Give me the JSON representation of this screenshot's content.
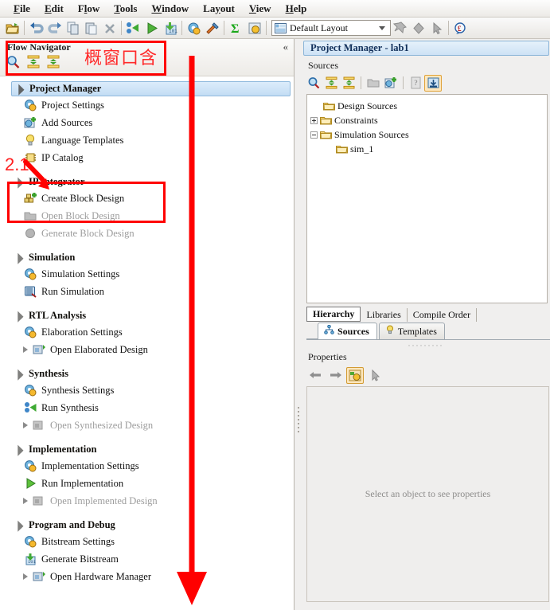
{
  "menubar": {
    "items": [
      {
        "label": "File",
        "mnemonic": "F"
      },
      {
        "label": "Edit",
        "mnemonic": "E"
      },
      {
        "label": "Flow",
        "mnemonic": "l"
      },
      {
        "label": "Tools",
        "mnemonic": "T"
      },
      {
        "label": "Window",
        "mnemonic": "W"
      },
      {
        "label": "Layout",
        "mnemonic": "y"
      },
      {
        "label": "View",
        "mnemonic": "V"
      },
      {
        "label": "Help",
        "mnemonic": "H"
      }
    ]
  },
  "toolbar": {
    "buttons": [
      {
        "name": "open-project-icon"
      },
      {
        "name": "undo-icon"
      },
      {
        "name": "redo-icon"
      },
      {
        "name": "copy-icon"
      },
      {
        "name": "paste-icon"
      },
      {
        "name": "delete-icon"
      },
      {
        "name": "run-synthesis-icon"
      },
      {
        "name": "run-implementation-icon"
      },
      {
        "name": "generate-bitstream-icon"
      },
      {
        "name": "project-settings-icon"
      },
      {
        "name": "tools-settings-icon"
      },
      {
        "name": "sum-report-icon"
      },
      {
        "name": "options-icon"
      }
    ],
    "layout_combo": {
      "value": "Default Layout",
      "icon": "layout-icon"
    },
    "right_buttons": [
      {
        "name": "pin-icon"
      },
      {
        "name": "marker-icon"
      },
      {
        "name": "cursor-icon"
      },
      {
        "name": "help-search-icon"
      }
    ]
  },
  "flow_navigator": {
    "title": "Flow Navigator",
    "collapse_label": "«",
    "header_icons": [
      {
        "name": "search-icon"
      },
      {
        "name": "collapse-all-icon"
      },
      {
        "name": "expand-all-icon"
      }
    ],
    "sections": [
      {
        "id": "project-manager",
        "label": "Project Manager",
        "selected": true,
        "items": [
          {
            "label": "Project Settings",
            "icon": "settings-gear-icon",
            "disabled": false,
            "expander": false
          },
          {
            "label": "Add Sources",
            "icon": "add-sources-icon",
            "disabled": false,
            "expander": false
          },
          {
            "label": "Language Templates",
            "icon": "lightbulb-icon",
            "disabled": false,
            "expander": false
          },
          {
            "label": "IP Catalog",
            "icon": "ip-catalog-icon",
            "disabled": false,
            "expander": false
          }
        ]
      },
      {
        "id": "ip-integrator",
        "label": "IP Integrator",
        "selected": false,
        "items": [
          {
            "label": "Create Block Design",
            "icon": "create-block-design-icon",
            "disabled": false,
            "expander": false
          },
          {
            "label": "Open Block Design",
            "icon": "open-block-design-icon",
            "disabled": true,
            "expander": false
          },
          {
            "label": "Generate Block Design",
            "icon": "generate-block-design-icon",
            "disabled": true,
            "expander": false
          }
        ]
      },
      {
        "id": "simulation",
        "label": "Simulation",
        "selected": false,
        "items": [
          {
            "label": "Simulation Settings",
            "icon": "settings-gear-icon",
            "disabled": false,
            "expander": false
          },
          {
            "label": "Run Simulation",
            "icon": "run-simulation-icon",
            "disabled": false,
            "expander": false
          }
        ]
      },
      {
        "id": "rtl-analysis",
        "label": "RTL Analysis",
        "selected": false,
        "items": [
          {
            "label": "Elaboration Settings",
            "icon": "settings-gear-icon",
            "disabled": false,
            "expander": false
          },
          {
            "label": "Open Elaborated Design",
            "icon": "open-design-icon",
            "disabled": false,
            "expander": true
          }
        ]
      },
      {
        "id": "synthesis",
        "label": "Synthesis",
        "selected": false,
        "items": [
          {
            "label": "Synthesis Settings",
            "icon": "settings-gear-icon",
            "disabled": false,
            "expander": false
          },
          {
            "label": "Run Synthesis",
            "icon": "run-synthesis-icon",
            "disabled": false,
            "expander": false
          },
          {
            "label": "Open Synthesized Design",
            "icon": "open-design-icon",
            "disabled": true,
            "expander": true
          }
        ]
      },
      {
        "id": "implementation",
        "label": "Implementation",
        "selected": false,
        "items": [
          {
            "label": "Implementation Settings",
            "icon": "settings-gear-icon",
            "disabled": false,
            "expander": false
          },
          {
            "label": "Run Implementation",
            "icon": "run-play-icon",
            "disabled": false,
            "expander": false
          },
          {
            "label": "Open Implemented Design",
            "icon": "open-design-icon",
            "disabled": true,
            "expander": true
          }
        ]
      },
      {
        "id": "program-and-debug",
        "label": "Program and Debug",
        "selected": false,
        "items": [
          {
            "label": "Bitstream Settings",
            "icon": "settings-gear-icon",
            "disabled": false,
            "expander": false
          },
          {
            "label": "Generate Bitstream",
            "icon": "generate-bitstream-icon",
            "disabled": false,
            "expander": false
          },
          {
            "label": "Open Hardware Manager",
            "icon": "open-design-icon",
            "disabled": false,
            "expander": true
          }
        ]
      }
    ]
  },
  "project_manager": {
    "title": "Project Manager",
    "separator": "-",
    "project_name": "lab1",
    "sources": {
      "label": "Sources",
      "toolbar": [
        {
          "name": "search-icon",
          "active": false
        },
        {
          "name": "collapse-all-icon",
          "active": false
        },
        {
          "name": "expand-all-icon",
          "active": false
        },
        {
          "name": "open-file-icon",
          "active": false
        },
        {
          "name": "add-sources-icon",
          "active": false
        },
        {
          "name": "properties-icon",
          "active": false
        },
        {
          "name": "save-icon",
          "active": true
        }
      ],
      "tree": [
        {
          "label": "Design Sources",
          "state": "leaf",
          "indent": 1
        },
        {
          "label": "Constraints",
          "state": "plus",
          "indent": 1
        },
        {
          "label": "Simulation Sources",
          "state": "minus",
          "indent": 1
        },
        {
          "label": "sim_1",
          "state": "leaf",
          "indent": 2
        }
      ],
      "view_tabs": [
        {
          "label": "Hierarchy",
          "selected": true
        },
        {
          "label": "Libraries",
          "selected": false
        },
        {
          "label": "Compile Order",
          "selected": false
        }
      ],
      "panel_tabs": [
        {
          "label": "Sources",
          "icon": "sources-tree-icon",
          "selected": true
        },
        {
          "label": "Templates",
          "icon": "lightbulb-icon",
          "selected": false
        }
      ]
    },
    "properties": {
      "label": "Properties",
      "toolbar": [
        {
          "name": "back-arrow-icon",
          "active": false
        },
        {
          "name": "forward-arrow-icon",
          "active": false
        },
        {
          "name": "properties-icon",
          "active": true
        },
        {
          "name": "cursor-icon",
          "active": false
        }
      ],
      "empty_message": "Select an object to see properties"
    }
  },
  "annotations": {
    "chinese_note": "概窗口含",
    "step_number": "2.1",
    "box_color": "#ff0000",
    "boxes": [
      {
        "name": "flow-navigator-header-highlight"
      },
      {
        "name": "ip-integrator-highlight"
      }
    ],
    "arrows": [
      {
        "name": "step-2-1-arrow"
      },
      {
        "name": "long-down-arrow"
      }
    ]
  }
}
